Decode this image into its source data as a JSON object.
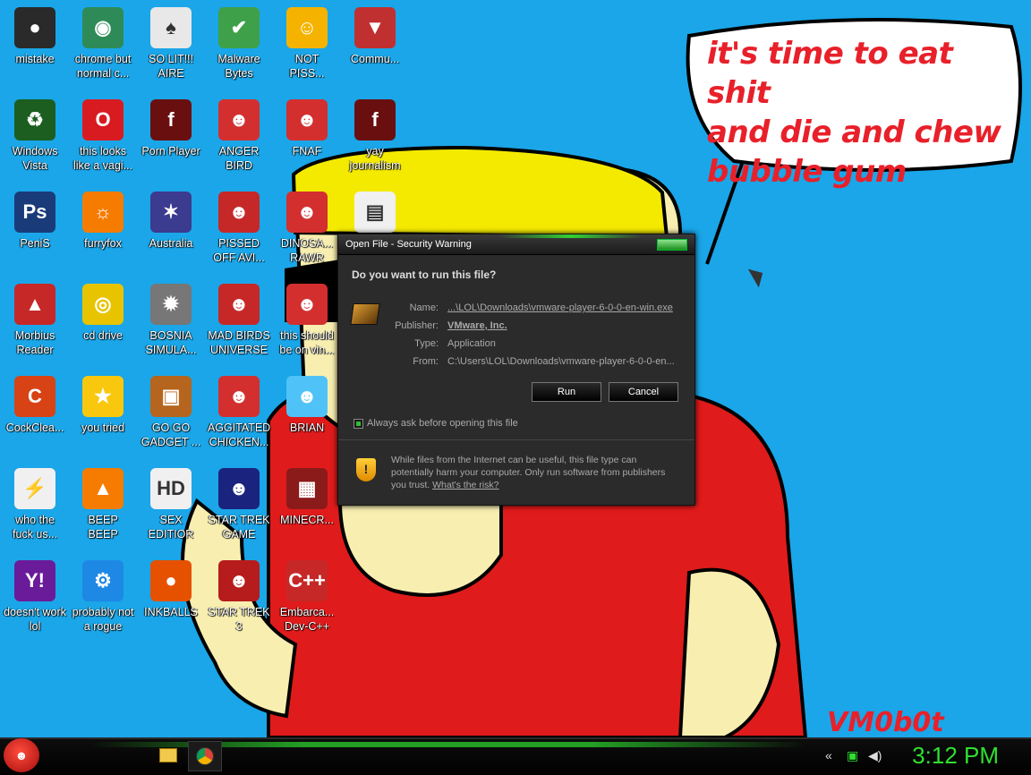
{
  "desktop": {
    "icons": [
      {
        "label": "mistake",
        "color": "#2a2a2a",
        "glyph": "●"
      },
      {
        "label": "chrome but\nnormal c...",
        "color": "#2e8b57",
        "glyph": "◉"
      },
      {
        "label": "SO LIT!!!\nAIRE",
        "color": "#e8e8e8",
        "glyph": "♠"
      },
      {
        "label": "Malware\nBytes",
        "color": "#3fa04a",
        "glyph": "✔"
      },
      {
        "label": "NOT\nPISS...",
        "color": "#f5b300",
        "glyph": "☺"
      },
      {
        "label": "Commu...",
        "color": "#c03030",
        "glyph": "▼"
      },
      {
        "label": "Windows\nVista",
        "color": "#1b5e20",
        "glyph": "♻"
      },
      {
        "label": "this looks\nlike a vagi...",
        "color": "#d81b20",
        "glyph": "O"
      },
      {
        "label": "Porn Player",
        "color": "#6a0f0f",
        "glyph": "f"
      },
      {
        "label": "ANGER\nBIRD",
        "color": "#d32f2f",
        "glyph": "☻"
      },
      {
        "label": "FNAF",
        "color": "#d32f2f",
        "glyph": "☻"
      },
      {
        "label": "yay\njournalism",
        "color": "#6a0f0f",
        "glyph": "f"
      },
      {
        "label": "PeniS",
        "color": "#1a3b7a",
        "glyph": "Ps"
      },
      {
        "label": "furryfox",
        "color": "#f57c00",
        "glyph": "☼"
      },
      {
        "label": "Australia",
        "color": "#3b3b8f",
        "glyph": "✶"
      },
      {
        "label": "PISSED\nOFF AVI...",
        "color": "#c62828",
        "glyph": "☻"
      },
      {
        "label": "DINOSA...\nRAWR",
        "color": "#d32f2f",
        "glyph": "☻"
      },
      {
        "label": "",
        "color": "#f0f0f0",
        "glyph": "▤"
      },
      {
        "label": "Morbius\nReader",
        "color": "#c62828",
        "glyph": "▲"
      },
      {
        "label": "cd drive",
        "color": "#e8c400",
        "glyph": "◎"
      },
      {
        "label": "BOSNIA\nSIMULA...",
        "color": "#777777",
        "glyph": "✹"
      },
      {
        "label": "MAD BIRDS\nUNIVERSE",
        "color": "#c62828",
        "glyph": "☻"
      },
      {
        "label": "this should\nbe on vin...",
        "color": "#d32f2f",
        "glyph": "☻"
      },
      {
        "label": "CockClea...",
        "color": "#d84315",
        "glyph": "C"
      },
      {
        "label": "you tried",
        "color": "#f9c80e",
        "glyph": "★"
      },
      {
        "label": "GO GO\nGADGET ...",
        "color": "#b5651d",
        "glyph": "▣"
      },
      {
        "label": "AGGITATED\nCHICKEN...",
        "color": "#d32f2f",
        "glyph": "☻"
      },
      {
        "label": "BRIAN",
        "color": "#4fc3f7",
        "glyph": "☻"
      },
      {
        "label": "who the\nfuck us...",
        "color": "#f0f0f0",
        "glyph": "⚡"
      },
      {
        "label": "BEEP\nBEEP",
        "color": "#f57c00",
        "glyph": "▲"
      },
      {
        "label": "SEX\nEDITIOR",
        "color": "#f0f0f0",
        "glyph": "HD"
      },
      {
        "label": "STAR TREK\nGAME",
        "color": "#1a237e",
        "glyph": "☻"
      },
      {
        "label": "MINECR...",
        "color": "#8b1a1a",
        "glyph": "▦"
      },
      {
        "label": "doesn't work\nlol",
        "color": "#6a1b9a",
        "glyph": "Y!"
      },
      {
        "label": "probably not\na rogue",
        "color": "#1e88e5",
        "glyph": "⚙"
      },
      {
        "label": "INKBALLS",
        "color": "#e65100",
        "glyph": "●"
      },
      {
        "label": "STAR TREK\n3",
        "color": "#b71c1c",
        "glyph": "☻"
      },
      {
        "label": "Embarca...\nDev-C++",
        "color": "#c62828",
        "glyph": "C++"
      }
    ]
  },
  "wallpaper": {
    "speech": [
      "it's time to eat shit",
      "and die and chew",
      "bubble gum"
    ],
    "signature": "VM0b0t"
  },
  "dialog": {
    "title": "Open File - Security Warning",
    "question": "Do you want to run this file?",
    "fields": [
      {
        "key": "Name:",
        "value": "...\\LOL\\Downloads\\vmware-player-6-0-0-en-win.exe",
        "link": true
      },
      {
        "key": "Publisher:",
        "value": "VMware, Inc.",
        "link": true
      },
      {
        "key": "Type:",
        "value": "Application",
        "link": false
      },
      {
        "key": "From:",
        "value": "C:\\Users\\LOL\\Downloads\\vmware-player-6-0-0-en...",
        "link": false
      }
    ],
    "run_label": "Run",
    "cancel_label": "Cancel",
    "checkbox_label": "Always ask before opening this file",
    "warning_text": "While files from the Internet can be useful, this file type can potentially harm your computer. Only run software from publishers you trust.",
    "risk_link": "What's the risk?"
  },
  "taskbar": {
    "start_glyph": "☻",
    "clock": "3:12 PM"
  }
}
